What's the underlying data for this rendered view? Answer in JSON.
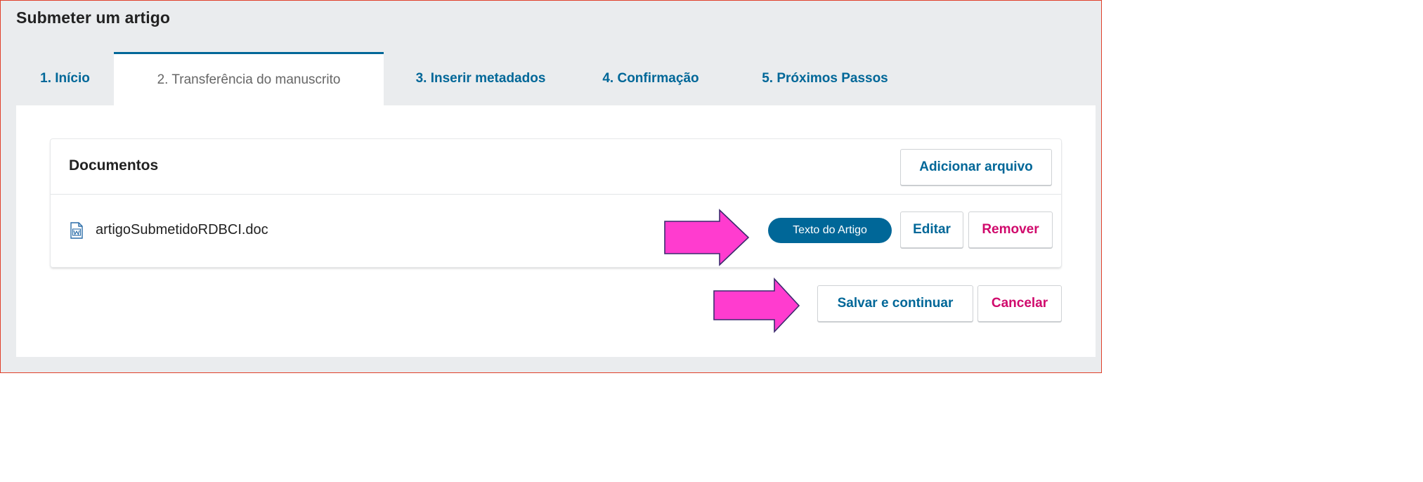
{
  "page": {
    "title": "Submeter um artigo"
  },
  "tabs": [
    {
      "label": "1. Início",
      "active": false
    },
    {
      "label": "2. Transferência do manuscrito",
      "active": true
    },
    {
      "label": "3. Inserir metadados",
      "active": false
    },
    {
      "label": "4. Confirmação",
      "active": false
    },
    {
      "label": "5. Próximos Passos",
      "active": false
    }
  ],
  "documents": {
    "title": "Documentos",
    "add_button": "Adicionar arquivo",
    "files": [
      {
        "name": "artigoSubmetidoRDBCI.doc",
        "icon": "word-document-icon",
        "genre_badge": "Texto do Artigo",
        "edit_label": "Editar",
        "remove_label": "Remover"
      }
    ]
  },
  "actions": {
    "save_label": "Salvar e continuar",
    "cancel_label": "Cancelar"
  },
  "colors": {
    "primary": "#006798",
    "danger": "#d00a6c",
    "annotation_arrow": "#ff3ccf",
    "frame_border": "#e0402a"
  }
}
